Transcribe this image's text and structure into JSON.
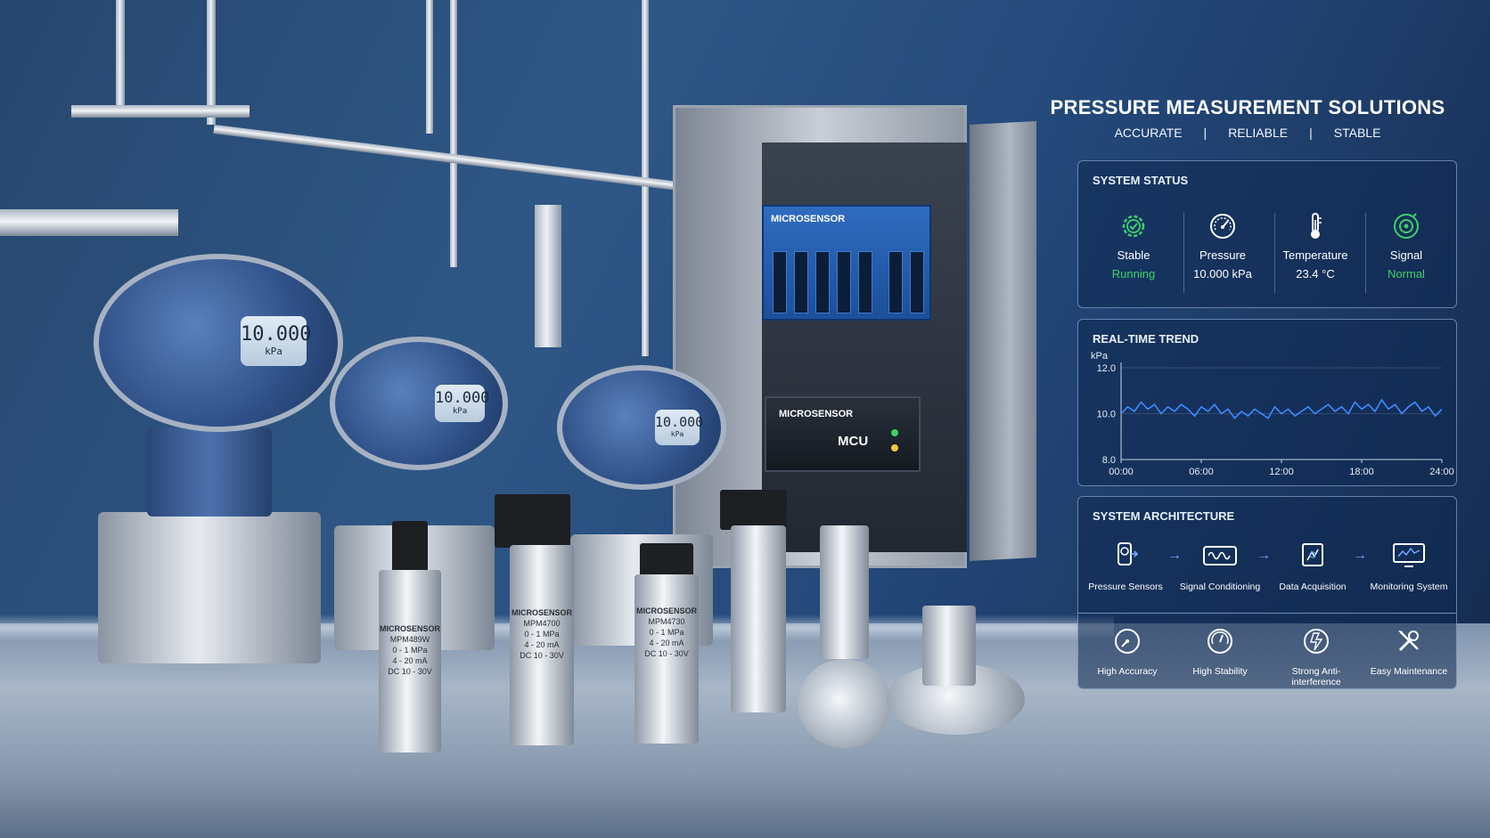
{
  "hero": {
    "title": "PRESSURE MEASUREMENT SOLUTIONS",
    "taglines": [
      "ACCURATE",
      "RELIABLE",
      "STABLE"
    ],
    "separator": "|"
  },
  "system_status": {
    "title": "SYSTEM STATUS",
    "items": [
      {
        "label": "Stable",
        "value": "Running",
        "icon": "gear-check-icon",
        "value_color": "#3ed16a"
      },
      {
        "label": "Pressure",
        "value": "10.000 kPa",
        "icon": "gauge-icon",
        "value_color": "#ffffff"
      },
      {
        "label": "Temperature",
        "value": "23.4 °C",
        "icon": "thermometer-icon",
        "value_color": "#ffffff"
      },
      {
        "label": "Signal",
        "value": "Normal",
        "icon": "signal-target-icon",
        "value_color": "#3ed16a"
      }
    ]
  },
  "trend": {
    "title": "REAL-TIME TREND"
  },
  "chart_data": {
    "type": "line",
    "ylabel": "kPa",
    "ylim": [
      8.0,
      12.0
    ],
    "yticks": [
      "12.0",
      "10.0",
      "8.0"
    ],
    "xticks": [
      "00:00",
      "06:00",
      "12:00",
      "18:00",
      "24:00"
    ],
    "series": [
      {
        "x": [
          0,
          0.5,
          1,
          1.5,
          2,
          2.5,
          3,
          3.5,
          4,
          4.5,
          5,
          5.5,
          6,
          6.5,
          7,
          7.5,
          8,
          8.5,
          9,
          9.5,
          10,
          10.5,
          11,
          11.5,
          12,
          12.5,
          13,
          13.5,
          14,
          14.5,
          15,
          15.5,
          16,
          16.5,
          17,
          17.5,
          18,
          18.5,
          19,
          19.5,
          20,
          20.5,
          21,
          21.5,
          22,
          22.5,
          23,
          23.5,
          24
        ],
        "y": [
          10.0,
          10.3,
          10.1,
          10.5,
          10.2,
          10.4,
          10.0,
          10.3,
          10.1,
          10.4,
          10.2,
          9.9,
          10.3,
          10.1,
          10.4,
          10.0,
          10.2,
          9.8,
          10.1,
          9.9,
          10.2,
          10.0,
          9.8,
          10.3,
          10.0,
          10.2,
          9.9,
          10.1,
          10.3,
          10.0,
          10.2,
          10.4,
          10.1,
          10.3,
          10.0,
          10.5,
          10.2,
          10.4,
          10.1,
          10.6,
          10.2,
          10.4,
          10.0,
          10.3,
          10.5,
          10.1,
          10.3,
          9.9,
          10.2
        ],
        "color": "#3d8bff"
      }
    ],
    "grid": true
  },
  "architecture": {
    "title": "SYSTEM ARCHITECTURE",
    "steps": [
      {
        "label": "Pressure Sensors",
        "icon": "pressure-sensor-icon"
      },
      {
        "label": "Signal Conditioning",
        "icon": "signal-conditioning-icon"
      },
      {
        "label": "Data Acquisition",
        "icon": "data-acquisition-icon"
      },
      {
        "label": "Monitoring System",
        "icon": "monitor-icon"
      }
    ],
    "arrow": "→"
  },
  "features": [
    {
      "label": "High Accuracy",
      "icon": "accuracy-gauge-icon"
    },
    {
      "label": "High Stability",
      "icon": "stability-gauge-icon"
    },
    {
      "label": "Strong Anti-interference",
      "icon": "anti-interference-icon"
    },
    {
      "label": "Easy Maintenance",
      "icon": "tools-icon"
    }
  ],
  "scene": {
    "brand": "MICROSENSOR",
    "transmitter_display": "10.000",
    "transmitter_unit": "kPa",
    "mcu_label": "MCU",
    "sensors": [
      {
        "model": "MPM489W",
        "range": "0 - 1 MPa",
        "output": "4 - 20 mA",
        "supply": "DC 10 - 30V"
      },
      {
        "model": "MPM4700",
        "range": "0 - 1 MPa",
        "output": "4 - 20 mA",
        "supply": "DC 10 - 30V"
      },
      {
        "model": "MPM4730",
        "range": "0 - 1 MPa",
        "output": "4 - 20 mA",
        "supply": "DC 10 - 30V"
      }
    ]
  }
}
